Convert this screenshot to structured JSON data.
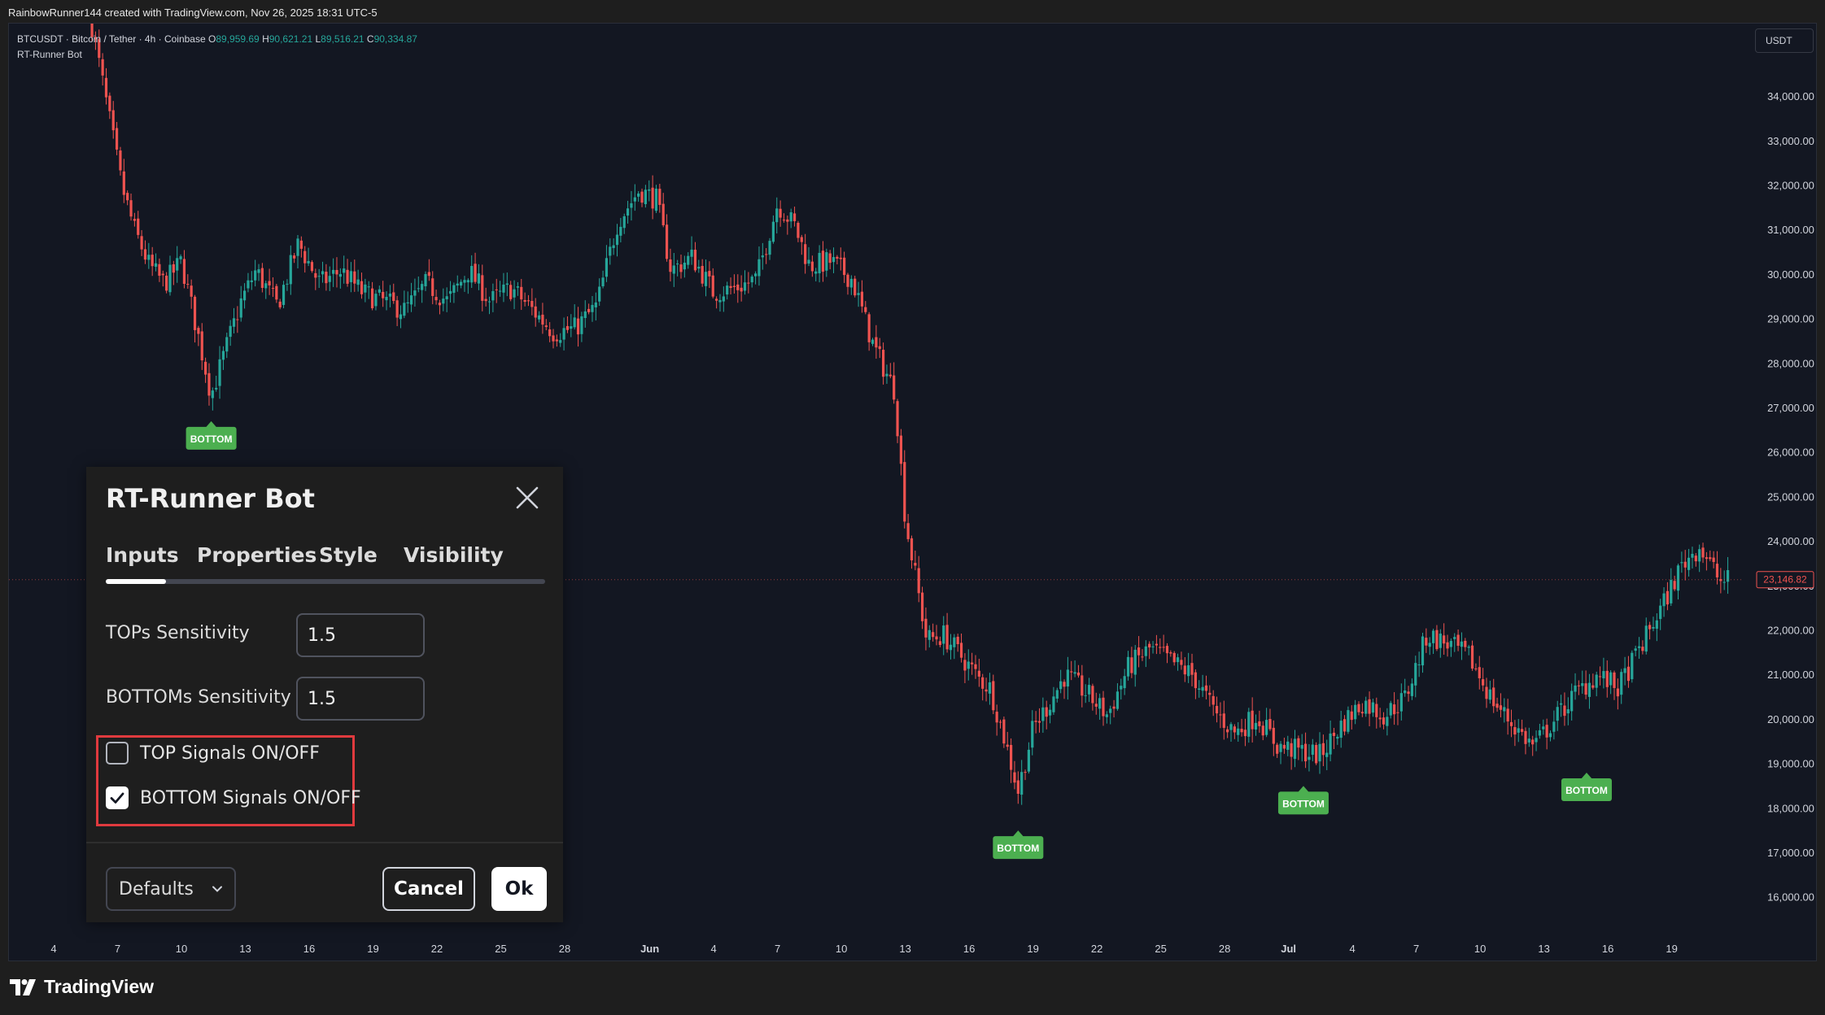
{
  "caption": "RainbowRunner144 created with TradingView.com, Nov 26, 2025 18:31 UTC-5",
  "legend": {
    "symbol_line": "BTCUSDT · Bitcoin / Tether · 4h · Coinbase",
    "o_label": "O",
    "o_value": "89,959.69",
    "h_label": "H",
    "h_value": "90,621.21",
    "l_label": "L",
    "l_value": "89,516.21",
    "c_label": "C",
    "c_value": "90,334.87",
    "indicator_name": "RT-Runner Bot"
  },
  "currency": "USDT",
  "last_price_label": "23,146.82",
  "colors": {
    "up": "#26a69a",
    "down": "#ef5350",
    "signal": "#4caf50",
    "background": "#131722",
    "highlight": "#e03a3e"
  },
  "chart_data": {
    "type": "candlestick",
    "y_ticks": [
      "34,000.00",
      "33,000.00",
      "32,000.00",
      "31,000.00",
      "30,000.00",
      "29,000.00",
      "28,000.00",
      "27,000.00",
      "26,000.00",
      "25,000.00",
      "24,000.00",
      "23,000.00",
      "22,000.00",
      "21,000.00",
      "20,000.00",
      "19,000.00",
      "18,000.00",
      "17,000.00",
      "16,000.00"
    ],
    "ylim": [
      15500,
      35500
    ],
    "x_ticks": [
      {
        "label": "4",
        "day": 4
      },
      {
        "label": "7",
        "day": 7
      },
      {
        "label": "10",
        "day": 10
      },
      {
        "label": "13",
        "day": 13
      },
      {
        "label": "16",
        "day": 16
      },
      {
        "label": "19",
        "day": 19
      },
      {
        "label": "22",
        "day": 22
      },
      {
        "label": "25",
        "day": 25
      },
      {
        "label": "28",
        "day": 28
      },
      {
        "label": "Jun",
        "day": 32,
        "bold": true
      },
      {
        "label": "4",
        "day": 35
      },
      {
        "label": "7",
        "day": 38
      },
      {
        "label": "10",
        "day": 41
      },
      {
        "label": "13",
        "day": 44
      },
      {
        "label": "16",
        "day": 47
      },
      {
        "label": "19",
        "day": 50
      },
      {
        "label": "22",
        "day": 53
      },
      {
        "label": "25",
        "day": 56
      },
      {
        "label": "28",
        "day": 59
      },
      {
        "label": "Jul",
        "day": 62,
        "bold": true
      },
      {
        "label": "4",
        "day": 65
      },
      {
        "label": "7",
        "day": 68
      },
      {
        "label": "10",
        "day": 71
      },
      {
        "label": "13",
        "day": 74
      },
      {
        "label": "16",
        "day": 77
      },
      {
        "label": "19",
        "day": 80
      }
    ],
    "xlim": [
      1.9,
      83.3
    ],
    "price_path": [
      [
        5.8,
        35600
      ],
      [
        6.5,
        33800
      ],
      [
        7.2,
        32000
      ],
      [
        7.8,
        31000
      ],
      [
        8.5,
        30200
      ],
      [
        9.2,
        29800
      ],
      [
        10.0,
        30300
      ],
      [
        10.8,
        28600
      ],
      [
        11.4,
        27300
      ],
      [
        12.0,
        28200
      ],
      [
        12.8,
        29400
      ],
      [
        13.5,
        30100
      ],
      [
        14.5,
        29300
      ],
      [
        15.5,
        30700
      ],
      [
        16.5,
        29800
      ],
      [
        17.5,
        30100
      ],
      [
        18.5,
        29600
      ],
      [
        19.5,
        29400
      ],
      [
        20.5,
        29200
      ],
      [
        21.5,
        29800
      ],
      [
        22.5,
        29400
      ],
      [
        23.5,
        30100
      ],
      [
        24.5,
        29400
      ],
      [
        25.5,
        29700
      ],
      [
        26.5,
        29200
      ],
      [
        27.5,
        28700
      ],
      [
        28.5,
        28800
      ],
      [
        29.5,
        29300
      ],
      [
        30.5,
        31200
      ],
      [
        31.5,
        31900
      ],
      [
        32.3,
        31700
      ],
      [
        33.0,
        30100
      ],
      [
        34.0,
        30400
      ],
      [
        35.0,
        29600
      ],
      [
        36.0,
        29700
      ],
      [
        37.0,
        29900
      ],
      [
        38.0,
        31600
      ],
      [
        38.8,
        31100
      ],
      [
        39.5,
        30200
      ],
      [
        40.5,
        30300
      ],
      [
        41.5,
        29900
      ],
      [
        42.5,
        28400
      ],
      [
        43.5,
        27400
      ],
      [
        44.0,
        24500
      ],
      [
        45.0,
        21800
      ],
      [
        45.8,
        21900
      ],
      [
        46.5,
        21500
      ],
      [
        47.5,
        20900
      ],
      [
        48.0,
        20700
      ],
      [
        48.7,
        19500
      ],
      [
        49.3,
        18400
      ],
      [
        50.0,
        19800
      ],
      [
        50.8,
        20400
      ],
      [
        51.5,
        21000
      ],
      [
        52.5,
        20600
      ],
      [
        53.5,
        20100
      ],
      [
        54.5,
        21200
      ],
      [
        55.5,
        21600
      ],
      [
        56.5,
        21300
      ],
      [
        57.5,
        21000
      ],
      [
        58.5,
        20200
      ],
      [
        59.5,
        19700
      ],
      [
        60.5,
        20100
      ],
      [
        61.5,
        19400
      ],
      [
        62.5,
        19300
      ],
      [
        63.5,
        19200
      ],
      [
        64.5,
        19900
      ],
      [
        65.5,
        20400
      ],
      [
        66.5,
        20100
      ],
      [
        67.5,
        20500
      ],
      [
        68.5,
        21900
      ],
      [
        69.5,
        21700
      ],
      [
        70.5,
        21400
      ],
      [
        71.5,
        20500
      ],
      [
        72.5,
        19900
      ],
      [
        73.5,
        19400
      ],
      [
        74.5,
        20000
      ],
      [
        75.5,
        20600
      ],
      [
        76.5,
        21000
      ],
      [
        77.5,
        20700
      ],
      [
        78.5,
        21600
      ],
      [
        79.5,
        22500
      ],
      [
        80.5,
        23500
      ],
      [
        81.3,
        23900
      ],
      [
        82.3,
        23100
      ],
      [
        82.8,
        23146
      ]
    ],
    "signals": [
      {
        "label": "BOTTOM",
        "day": 11.4,
        "price": 26600
      },
      {
        "label": "BOTTOM",
        "day": 49.3,
        "price": 17400
      },
      {
        "label": "BOTTOM",
        "day": 62.7,
        "price": 18400
      },
      {
        "label": "BOTTOM",
        "day": 76.0,
        "price": 18700
      }
    ]
  },
  "dialog": {
    "title": "RT-Runner Bot",
    "tabs": [
      "Inputs",
      "Properties",
      "Style",
      "Visibility"
    ],
    "active_tab": "Inputs",
    "fields": [
      {
        "label": "TOPs Sensitivity",
        "value": "1.5"
      },
      {
        "label": "BOTTOMs Sensitivity",
        "value": "1.5"
      }
    ],
    "checkboxes": [
      {
        "label": "TOP Signals ON/OFF",
        "checked": false
      },
      {
        "label": "BOTTOM Signals ON/OFF",
        "checked": true
      }
    ],
    "defaults_label": "Defaults",
    "cancel_label": "Cancel",
    "ok_label": "Ok"
  },
  "brand": "TradingView"
}
